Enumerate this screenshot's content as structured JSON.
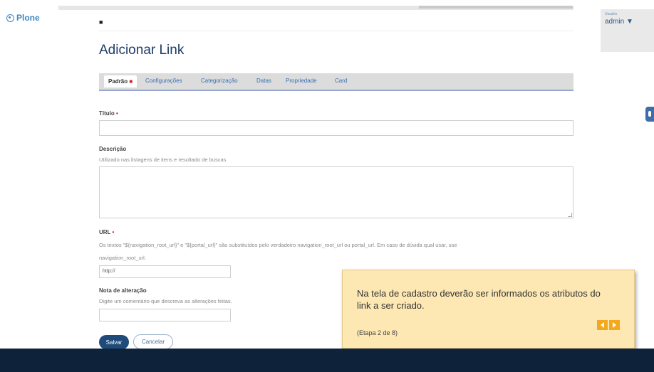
{
  "brand": {
    "name": "Plone"
  },
  "user": {
    "caption": "Usuário",
    "name": "admin ▼"
  },
  "breadcrumb": {
    "home_icon": "home-icon"
  },
  "page": {
    "title": "Adicionar Link"
  },
  "tabs": [
    {
      "label": "Padrão",
      "active": true
    },
    {
      "label": "Configurações"
    },
    {
      "label": "Categorização"
    },
    {
      "label": "Datas"
    },
    {
      "label": "Propriedade"
    },
    {
      "label": "Card"
    }
  ],
  "required_mark": "■",
  "required_star": "•",
  "form": {
    "title": {
      "label": "Título",
      "value": ""
    },
    "description": {
      "label": "Descrição",
      "help": "Utilizado nas listagens de itens e resultado de buscas",
      "value": ""
    },
    "url": {
      "label": "URL",
      "help_line1": "Os textos \"${navigation_root_url}\" e \"${portal_url}\" são substituídos pelo verdadeiro navigation_root_url ou portal_url. Em caso de dúvida qual usar, use",
      "help_line2": "navigation_root_url.",
      "value": "http://"
    },
    "change_note": {
      "label": "Nota de alteração",
      "help": "Digite um comentário que descreva as alterações feitas.",
      "value": ""
    }
  },
  "buttons": {
    "save": "Salvar",
    "cancel": "Cancelar"
  },
  "tooltip": {
    "text": "Na tela de cadastro deverão ser informados os atributos do link a ser criado.",
    "step": "(Etapa 2 de 8)",
    "prev_icon": "arrow-left-icon",
    "next_icon": "arrow-right-icon"
  },
  "colors": {
    "accent": "#1f4b7a",
    "tooltip_bg": "#fde7b3",
    "tooltip_nav": "#f3a81e",
    "footer": "#0e2339",
    "required": "#cc2222"
  }
}
